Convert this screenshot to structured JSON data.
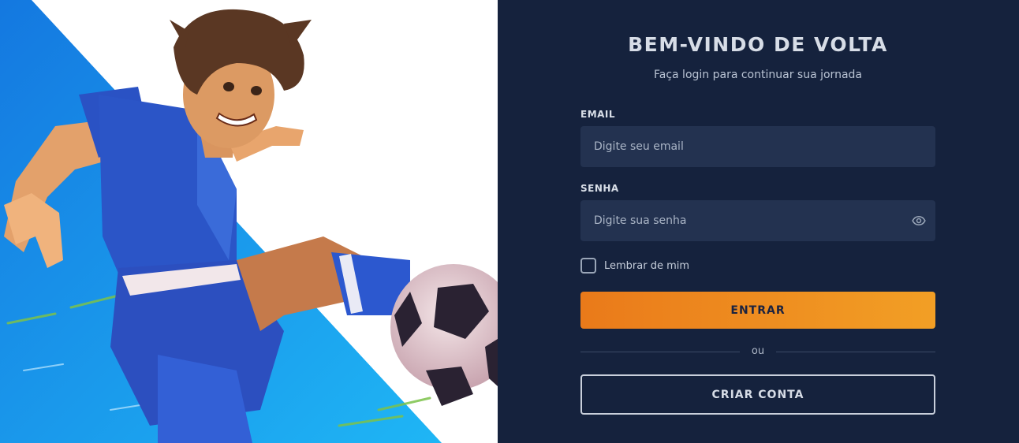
{
  "login": {
    "title": "BEM-VINDO DE VOLTA",
    "subtitle": "Faça login para continuar sua jornada",
    "email": {
      "label": "EMAIL",
      "placeholder": "Digite seu email",
      "value": ""
    },
    "password": {
      "label": "SENHA",
      "placeholder": "Digite sua senha",
      "value": "",
      "toggle_icon": "eye-icon"
    },
    "remember": {
      "label": "Lembrar de mim",
      "checked": false
    },
    "submit_label": "ENTRAR",
    "divider_label": "ou",
    "create_account_label": "CRIAR CONTA"
  },
  "colors": {
    "panel_bg": "#15223d",
    "field_bg": "#233250",
    "accent_start": "#ea7a1a",
    "accent_end": "#f29f25",
    "hero_blue": "#1d8fe8"
  },
  "hero": {
    "illustration": "soccer-player-kicking-ball"
  }
}
